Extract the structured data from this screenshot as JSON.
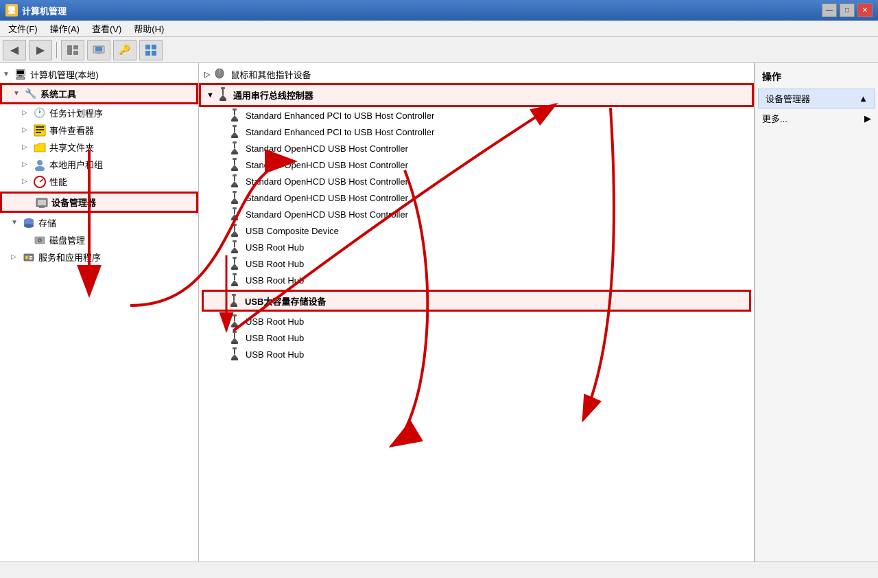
{
  "window": {
    "title": "计算机管理",
    "title_icon": "🖥️",
    "controls": [
      "—",
      "□",
      "✕"
    ]
  },
  "menu": {
    "items": [
      {
        "label": "文件(F)"
      },
      {
        "label": "操作(A)"
      },
      {
        "label": "查看(V)"
      },
      {
        "label": "帮助(H)"
      }
    ]
  },
  "toolbar": {
    "buttons": [
      "◀",
      "▶",
      "🗋",
      "⊞",
      "🔑",
      "▣"
    ]
  },
  "sidebar": {
    "root_label": "计算机管理(本地)",
    "items": [
      {
        "label": "系统工具",
        "indent": 1,
        "expanded": true,
        "highlighted": true
      },
      {
        "label": "任务计划程序",
        "indent": 2,
        "icon": "🕐"
      },
      {
        "label": "事件查看器",
        "indent": 2,
        "icon": "📋"
      },
      {
        "label": "共享文件夹",
        "indent": 2,
        "icon": "📁"
      },
      {
        "label": "本地用户和组",
        "indent": 2,
        "icon": "👥"
      },
      {
        "label": "性能",
        "indent": 2,
        "icon": "⊘"
      },
      {
        "label": "设备管理器",
        "indent": 2,
        "highlighted": true
      },
      {
        "label": "存储",
        "indent": 1,
        "expanded": true
      },
      {
        "label": "磁盘管理",
        "indent": 2,
        "icon": "💾"
      },
      {
        "label": "服务和应用程序",
        "indent": 1
      }
    ]
  },
  "content": {
    "section_mouse": "鼠标和其他指针设备",
    "section_usb": "通用串行总线控制器",
    "devices": [
      {
        "label": "Standard Enhanced PCI to USB Host Controller"
      },
      {
        "label": "Standard Enhanced PCI to USB Host Controller"
      },
      {
        "label": "Standard OpenHCD USB Host Controller"
      },
      {
        "label": "Standard OpenHCD USB Host Controller"
      },
      {
        "label": "Standard OpenHCD USB Host Controller"
      },
      {
        "label": "Standard OpenHCD USB Host Controller"
      },
      {
        "label": "Standard OpenHCD USB Host Controller"
      },
      {
        "label": "USB Composite Device"
      },
      {
        "label": "USB Root Hub"
      },
      {
        "label": "USB Root Hub"
      },
      {
        "label": "USB Root Hub"
      },
      {
        "label": "USB大容量存储设备",
        "highlighted": true
      },
      {
        "label": "USB Root Hub"
      },
      {
        "label": "USB Root Hub"
      },
      {
        "label": "USB Root Hub"
      }
    ]
  },
  "actions": {
    "header": "操作",
    "items": [
      {
        "label": "设备管理器",
        "has_arrow": true
      },
      {
        "label": "更多...",
        "has_arrow": true
      }
    ]
  },
  "status": {
    "text": ""
  }
}
